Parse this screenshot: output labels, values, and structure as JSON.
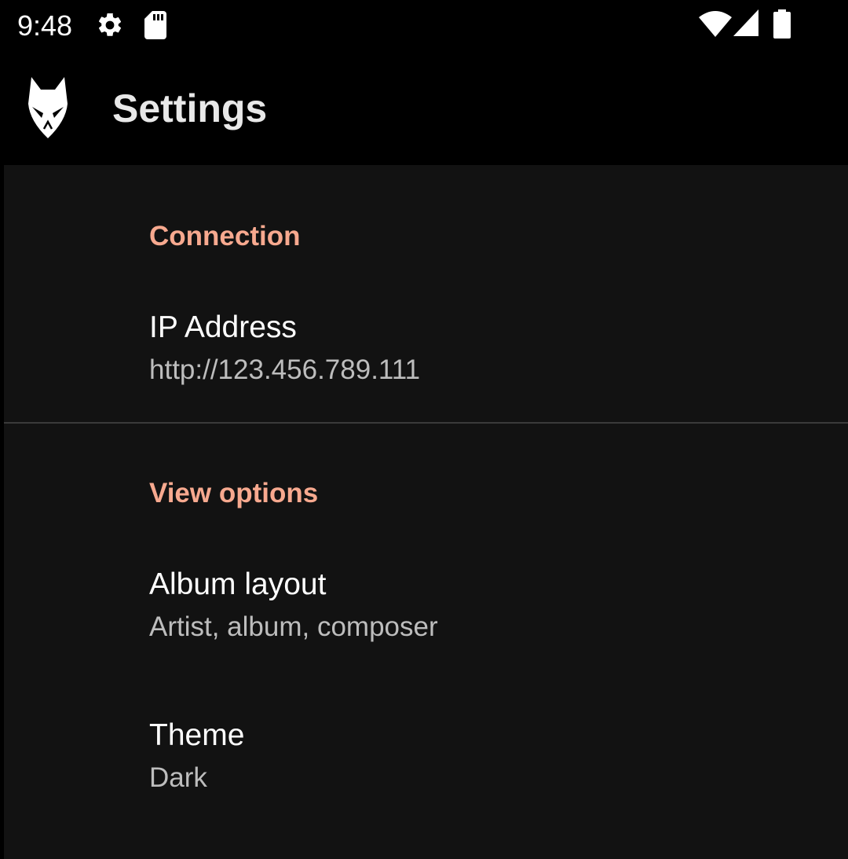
{
  "status_bar": {
    "time": "9:48",
    "icons": [
      "settings-gear-icon",
      "sd-card-icon",
      "wifi-icon",
      "cell-signal-icon",
      "battery-icon"
    ]
  },
  "app_bar": {
    "title": "Settings",
    "logo_icon": "foobar-fox-logo-icon"
  },
  "colors": {
    "category_accent": "#f7a98f",
    "content_background": "#121212",
    "bar_background": "#000000",
    "summary_text": "#bdbdbd"
  },
  "sections": [
    {
      "header": "Connection",
      "items": [
        {
          "title": "IP Address",
          "summary": "http://123.456.789.111"
        }
      ]
    },
    {
      "header": "View options",
      "items": [
        {
          "title": "Album layout",
          "summary": "Artist, album, composer"
        },
        {
          "title": "Theme",
          "summary": "Dark"
        }
      ]
    }
  ]
}
